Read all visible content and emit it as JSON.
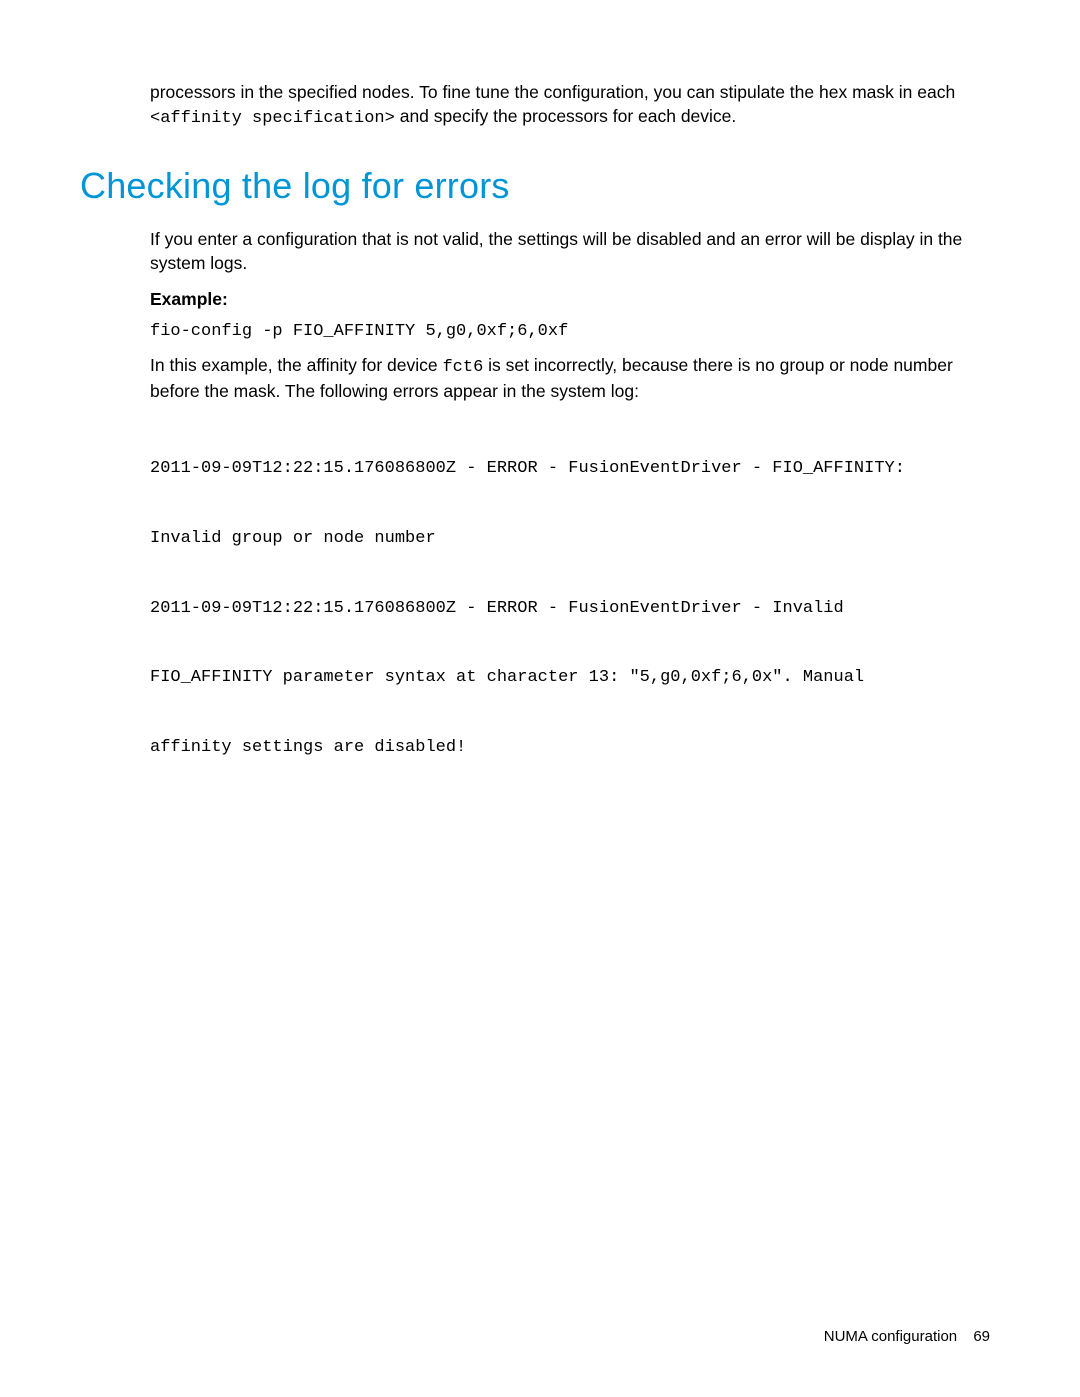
{
  "intro": {
    "text_before_code": "processors in the specified nodes. To fine tune the configuration, you can stipulate the hex mask in each ",
    "code": "<affinity specification>",
    "text_after_code": " and specify the processors for each device."
  },
  "heading": "Checking the log for errors",
  "para1": "If you enter a configuration that is not valid, the settings will be disabled and an error will be display in the system logs.",
  "example_label": "Example:",
  "command": "fio-config -p FIO_AFFINITY 5,g0,0xf;6,0xf",
  "para2": {
    "before_code": "In this example, the affinity for device ",
    "code": "fct6",
    "after_code": " is set incorrectly, because there is no group or node number before the mask. The following errors appear in the system log:"
  },
  "log_lines": [
    "2011-09-09T12:22:15.176086800Z - ERROR - FusionEventDriver - FIO_AFFINITY:",
    "Invalid group or node number",
    "2011-09-09T12:22:15.176086800Z - ERROR - FusionEventDriver - Invalid",
    "FIO_AFFINITY parameter syntax at character 13: \"5,g0,0xf;6,0x\". Manual",
    "affinity settings are disabled!"
  ],
  "footer": {
    "section": "NUMA configuration",
    "page": "69"
  }
}
